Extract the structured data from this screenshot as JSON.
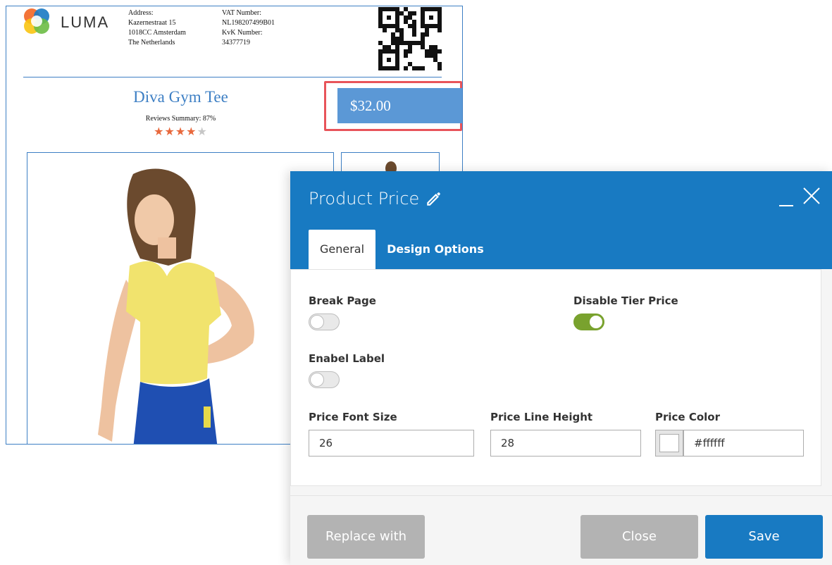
{
  "document": {
    "logo_text": "LUMA",
    "address_lines": [
      "Address:",
      "Kazernestraat 15",
      "1018CC Amsterdam",
      "The Netherlands"
    ],
    "vat_lines": [
      "VAT Number:",
      "NL198207499B01",
      "KvK Number:",
      "34377719"
    ],
    "product_name": "Diva Gym Tee",
    "reviews_summary": "Reviews Summary: 87%",
    "rating_stars": 4.35,
    "price": "$32.00",
    "price_highlight_color": "#e8545a",
    "accent_color": "#3d7fc4"
  },
  "modal": {
    "title": "Product Price",
    "title_icon": "pencil-icon",
    "tabs": [
      {
        "label": "General",
        "active": true
      },
      {
        "label": "Design Options",
        "active": false
      }
    ],
    "fields": {
      "break_page": {
        "label": "Break Page",
        "enabled": false
      },
      "disable_tier_price": {
        "label": "Disable Tier Price",
        "enabled": true
      },
      "enable_label": {
        "label": "Enabel Label",
        "enabled": false
      },
      "price_font_size": {
        "label": "Price Font Size",
        "value": "26"
      },
      "price_line_height": {
        "label": "Price Line Height",
        "value": "28"
      },
      "price_color": {
        "label": "Price Color",
        "value": "#ffffff"
      }
    },
    "buttons": {
      "replace": "Replace with",
      "close": "Close",
      "save": "Save"
    },
    "header_color": "#187ac2",
    "toggle_on_color": "#79a22e"
  }
}
